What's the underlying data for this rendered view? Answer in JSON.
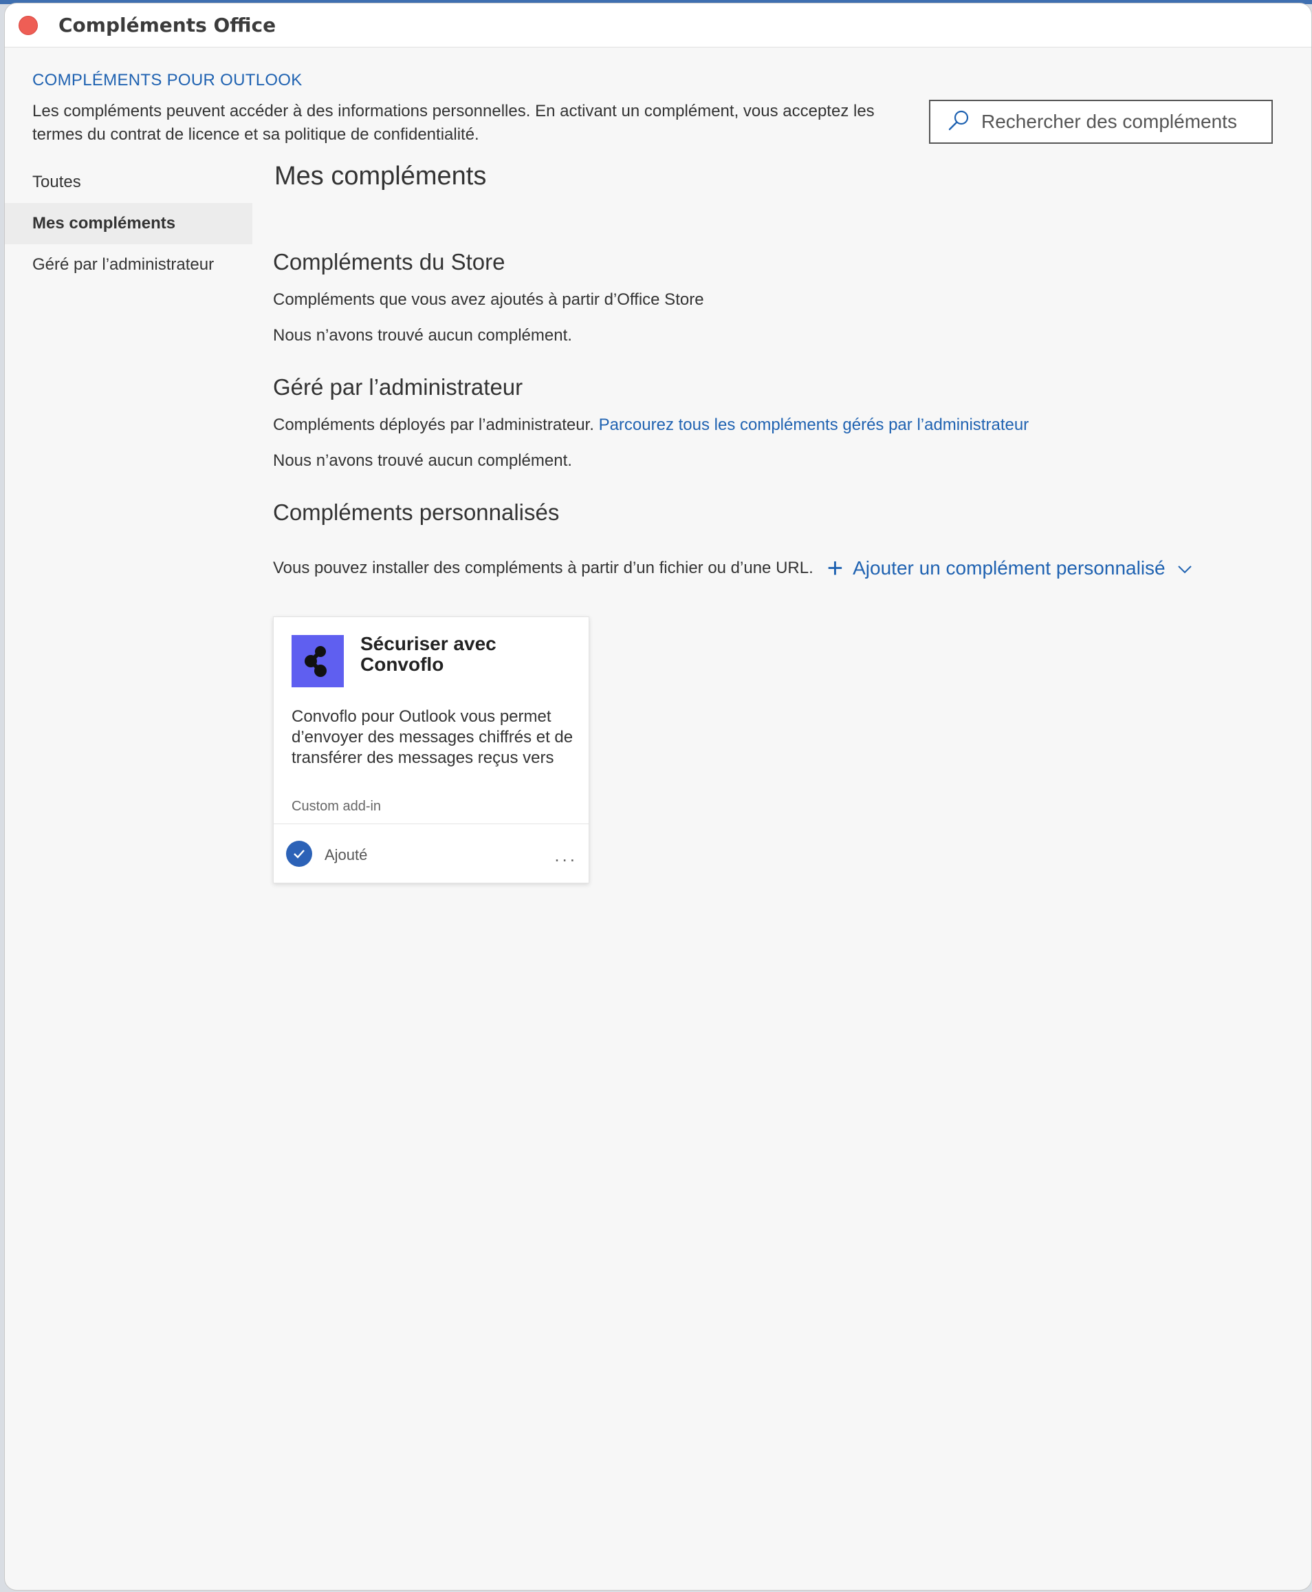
{
  "window": {
    "title": "Compléments Office"
  },
  "header": {
    "kicker": "COMPLÉMENTS POUR OUTLOOK",
    "notice_line1": "Les compléments peuvent accéder à des informations personnelles. En activant un complément, vous acceptez les",
    "notice_line2": "termes du contrat de licence et sa politique de confidentialité."
  },
  "search": {
    "placeholder": "Rechercher des compléments"
  },
  "sidebar": {
    "items": [
      {
        "label": "Toutes"
      },
      {
        "label": "Mes compléments"
      },
      {
        "label": "Géré par l’administrateur"
      }
    ]
  },
  "main": {
    "title": "Mes compléments",
    "store": {
      "title": "Compléments du Store",
      "subtitle": "Compléments que vous avez ajoutés à partir d’Office Store",
      "empty": "Nous n’avons trouvé aucun complément."
    },
    "admin": {
      "title": "Géré par l’administrateur",
      "subtitle": "Compléments déployés par l’administrateur.",
      "link": "Parcourez tous les compléments gérés par l’administrateur",
      "empty": "Nous n’avons trouvé aucun complément."
    },
    "custom": {
      "title": "Compléments personnalisés",
      "subtitle": "Vous pouvez installer des compléments à partir d’un fichier ou d’une URL.",
      "add_label": "Ajouter un complément personnalisé"
    },
    "card": {
      "title": "Sécuriser avec Convoflo",
      "description": "Convoflo pour Outlook vous permet d’envoyer des messages chiffrés et de transférer des messages reçus vers des",
      "tag": "Custom add-in",
      "status": "Ajouté",
      "more": "...",
      "logo_color": "#5f5ff0"
    }
  },
  "colors": {
    "accent": "#1f62b1",
    "close": "#ee5e55",
    "check": "#2c62b7"
  }
}
